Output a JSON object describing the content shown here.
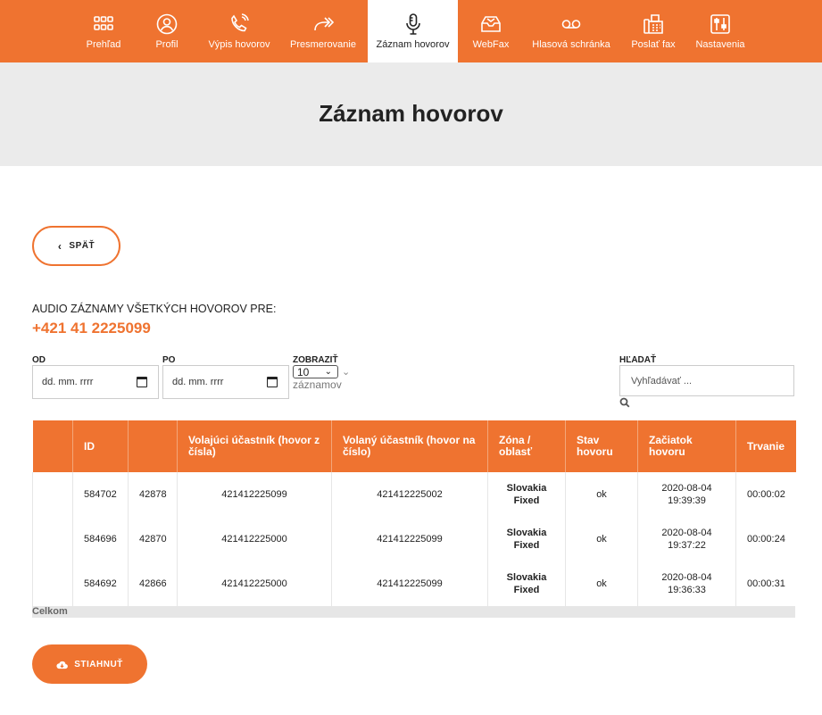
{
  "nav": {
    "items": [
      {
        "label": "Prehľad",
        "icon": "grid-icon"
      },
      {
        "label": "Profil",
        "icon": "user-icon"
      },
      {
        "label": "Výpis hovorov",
        "icon": "phone-icon"
      },
      {
        "label": "Presmerovanie",
        "icon": "forward-icon"
      },
      {
        "label": "Záznam hovorov",
        "icon": "microphone-icon",
        "active": true
      },
      {
        "label": "WebFax",
        "icon": "fax-inbox-icon"
      },
      {
        "label": "Hlasová schránka",
        "icon": "voicemail-icon"
      },
      {
        "label": "Poslať fax",
        "icon": "fax-icon"
      },
      {
        "label": "Nastavenia",
        "icon": "sliders-icon"
      }
    ]
  },
  "page": {
    "title": "Záznam hovorov",
    "back_label": "SPÄŤ",
    "audio_title": "AUDIO ZÁZNAMY VŠETKÝCH HOVOROV PRE:",
    "phone_number": "+421 41 2225099"
  },
  "filters": {
    "od_label": "OD",
    "od_value": "dd. mm. rrrr",
    "po_label": "PO",
    "po_value": "dd. mm. rrrr",
    "zobrazit_label": "ZOBRAZIŤ",
    "zobrazit_value": "10",
    "zobrazit_suffix": "záznamov",
    "search_label": "HĽADAŤ",
    "search_placeholder": "Vyhľadávať ..."
  },
  "table": {
    "headers": [
      "",
      "ID",
      "",
      "Volajúci účastník (hovor z čísla)",
      "Volaný účastník (hovor na číslo)",
      "Zóna / oblasť",
      "Stav hovoru",
      "Začiatok hovoru",
      "Trvanie"
    ],
    "rows": [
      {
        "id": "584702",
        "id2": "42878",
        "caller": "421412225099",
        "callee": "421412225002",
        "zone1": "Slovakia",
        "zone2": "Fixed",
        "status": "ok",
        "date": "2020-08-04",
        "time": "19:39:39",
        "duration": "00:00:02"
      },
      {
        "id": "584696",
        "id2": "42870",
        "caller": "421412225000",
        "callee": "421412225099",
        "zone1": "Slovakia",
        "zone2": "Fixed",
        "status": "ok",
        "date": "2020-08-04",
        "time": "19:37:22",
        "duration": "00:00:24"
      },
      {
        "id": "584692",
        "id2": "42866",
        "caller": "421412225000",
        "callee": "421412225099",
        "zone1": "Slovakia",
        "zone2": "Fixed",
        "status": "ok",
        "date": "2020-08-04",
        "time": "19:36:33",
        "duration": "00:00:31"
      }
    ],
    "total_label": "Celkom"
  },
  "download_label": "STIAHNUŤ",
  "colors": {
    "accent": "#ef7330",
    "hero_bg": "#ebebeb"
  }
}
